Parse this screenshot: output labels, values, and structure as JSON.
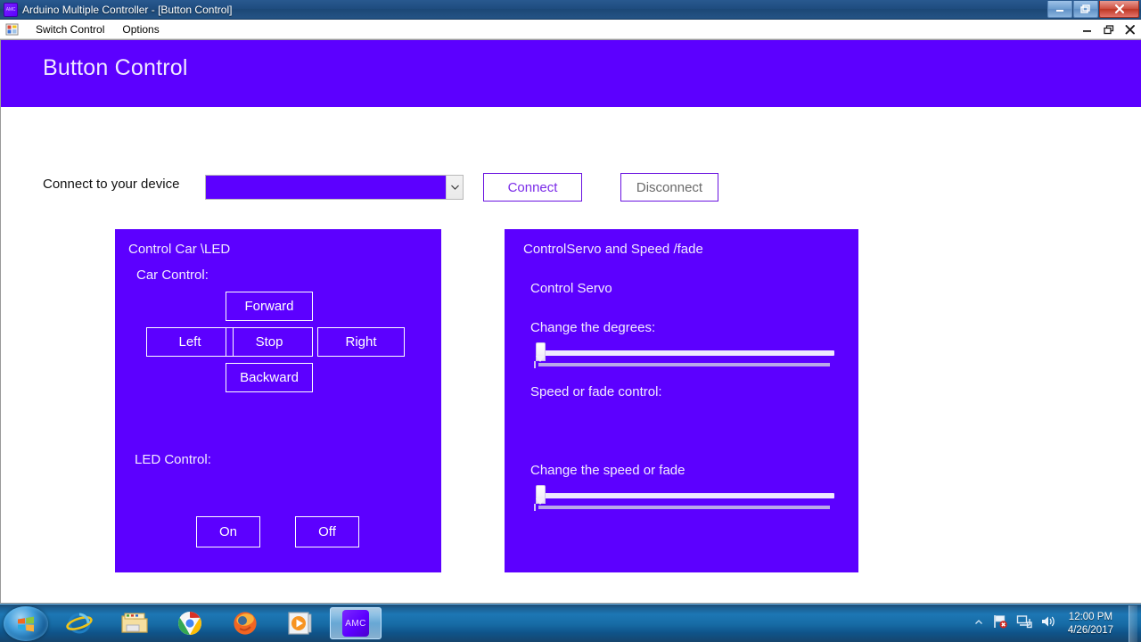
{
  "window": {
    "title": "Arduino Multiple Controller - [Button Control]",
    "app_icon": "amc-app-icon",
    "icon_label": "AMC",
    "controls": {
      "minimize": "minimize-button",
      "restore": "restore-button",
      "close": "close-button"
    }
  },
  "menubar": {
    "form_icon": "form-designer-icon",
    "items": [
      {
        "label": "Switch Control"
      },
      {
        "label": "Options"
      }
    ],
    "mdi_controls": {
      "minimize": "mdi-minimize-button",
      "restore": "mdi-restore-button",
      "close": "mdi-close-button"
    }
  },
  "header": {
    "title": "Button Control",
    "background": "#5c00ff",
    "text_color": "#efe9ff"
  },
  "connect_row": {
    "label": "Connect to your device",
    "combo": {
      "value": "",
      "placeholder": "",
      "arrow_icon": "chevron-down-icon",
      "fill": "#5c00ff"
    },
    "connect_button": {
      "label": "Connect",
      "color": "#7a2ae8"
    },
    "disconnect_button": {
      "label": "Disconnect",
      "color": "#6a6a6a"
    }
  },
  "panels": {
    "car": {
      "title": "Control Car \\LED",
      "car_section_label": "Car Control:",
      "buttons": {
        "forward": "Forward",
        "left": "Left",
        "stop": "Stop",
        "right": "Right",
        "backward": "Backward"
      },
      "led_section_label": "LED Control:",
      "led_buttons": {
        "on": "On",
        "off": "Off"
      }
    },
    "servo": {
      "title": "ControlServo  and Speed /fade",
      "servo_section_label": "Control Servo",
      "degrees_label": "Change the degrees:",
      "degrees_slider": {
        "value": 0,
        "min": 0,
        "max": 100
      },
      "speed_section_label": "Speed or fade control:",
      "speed_label": "Change the speed or fade",
      "speed_slider": {
        "value": 0,
        "min": 0,
        "max": 100
      }
    }
  },
  "taskbar": {
    "start_icon": "windows-start-orb-icon",
    "pinned": [
      {
        "name": "internet-explorer-icon"
      },
      {
        "name": "windows-explorer-icon"
      },
      {
        "name": "google-chrome-icon"
      },
      {
        "name": "firefox-icon"
      },
      {
        "name": "windows-media-player-icon"
      }
    ],
    "active_task": {
      "label": "AMC",
      "name": "amc-taskbar-button"
    },
    "tray": {
      "show_hidden_icon": "chevron-up-icon",
      "action_center_icon": "flag-alert-icon",
      "network_icon": "network-icon",
      "volume_icon": "volume-icon",
      "time": "12:00 PM",
      "date": "4/26/2017"
    }
  }
}
